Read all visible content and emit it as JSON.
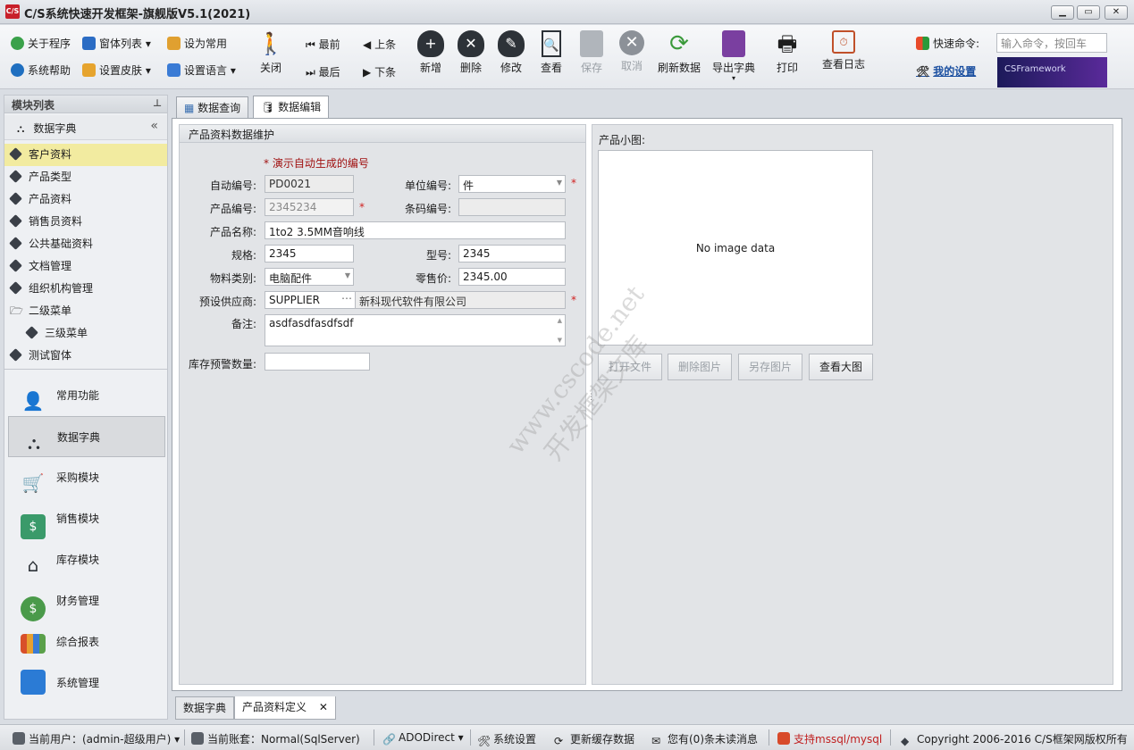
{
  "window": {
    "title": "C/S系统快速开发框架-旗舰版V5.1(2021)",
    "logo": "C/S"
  },
  "toolbar": {
    "small_buttons": [
      {
        "label": "关于程序",
        "icon": "question-green-icon"
      },
      {
        "label": "窗体列表",
        "icon": "windows-list-icon"
      },
      {
        "label": "设为常用",
        "icon": "bookmark-icon"
      },
      {
        "label": "系统帮助",
        "icon": "help-blue-icon"
      },
      {
        "label": "设置皮肤",
        "icon": "skin-icon"
      },
      {
        "label": "设置语言",
        "icon": "language-icon"
      }
    ],
    "close_label": "关闭",
    "nav": {
      "first": "最前",
      "prev": "上条",
      "last": "最后",
      "next": "下条"
    },
    "buttons": [
      {
        "label": "新增",
        "icon": "database-add-icon",
        "enabled": true
      },
      {
        "label": "删除",
        "icon": "database-delete-icon",
        "enabled": true
      },
      {
        "label": "修改",
        "icon": "database-edit-icon",
        "enabled": true
      },
      {
        "label": "查看",
        "icon": "view-document-icon",
        "enabled": true
      },
      {
        "label": "保存",
        "icon": "save-disk-icon",
        "enabled": false
      },
      {
        "label": "取消",
        "icon": "cancel-circle-icon",
        "enabled": false
      },
      {
        "label": "刷新数据",
        "icon": "refresh-icon",
        "enabled": true
      },
      {
        "label": "导出字典",
        "icon": "export-disk-icon",
        "enabled": true
      },
      {
        "label": "打印",
        "icon": "printer-icon",
        "enabled": true
      },
      {
        "label": "查看日志",
        "icon": "calendar-log-icon",
        "enabled": true
      }
    ],
    "quick_command_label": "快速命令:",
    "quick_command_placeholder": "输入命令，按回车",
    "my_settings": "我的设置",
    "brand_banner": "CSFramework"
  },
  "left_panel": {
    "header": "模块列表",
    "group_title": "数据字典",
    "tree": [
      {
        "label": "客户资料",
        "selected": true,
        "level": 0
      },
      {
        "label": "产品类型",
        "selected": false,
        "level": 0
      },
      {
        "label": "产品资料",
        "selected": false,
        "level": 0
      },
      {
        "label": "销售员资料",
        "selected": false,
        "level": 0
      },
      {
        "label": "公共基础资料",
        "selected": false,
        "level": 0
      },
      {
        "label": "文档管理",
        "selected": false,
        "level": 0
      },
      {
        "label": "组织机构管理",
        "selected": false,
        "level": 0
      },
      {
        "label": "二级菜单",
        "selected": false,
        "level": 0
      },
      {
        "label": "三级菜单",
        "selected": false,
        "level": 1
      },
      {
        "label": "测试窗体",
        "selected": false,
        "level": 0
      }
    ],
    "modules": [
      {
        "label": "常用功能",
        "icon": "user-location-icon"
      },
      {
        "label": "数据字典",
        "icon": "hierarchy-icon",
        "active": true
      },
      {
        "label": "采购模块",
        "icon": "cart-icon"
      },
      {
        "label": "销售模块",
        "icon": "sales-tag-icon"
      },
      {
        "label": "库存模块",
        "icon": "warehouse-house-icon"
      },
      {
        "label": "财务管理",
        "icon": "coins-icon"
      },
      {
        "label": "综合报表",
        "icon": "bar-chart-icon"
      },
      {
        "label": "系统管理",
        "icon": "windows-logo-icon"
      }
    ]
  },
  "tabs": [
    {
      "label": "数据查询",
      "icon": "grid-icon"
    },
    {
      "label": "数据编辑",
      "icon": "database-icon",
      "active": true
    }
  ],
  "form": {
    "title": "产品资料数据维护",
    "note": "* 演示自动生成的编号",
    "labels": {
      "auto_no": "自动编号:",
      "unit_no": "单位编号:",
      "product_no": "产品编号:",
      "barcode": "条码编号:",
      "name": "产品名称:",
      "spec": "规格:",
      "model": "型号:",
      "category": "物料类别:",
      "price": "零售价:",
      "supplier": "预设供应商:",
      "remark": "备注:",
      "stock_alert": "库存预警数量:"
    },
    "values": {
      "auto_no": "PD0021",
      "unit_no": "件",
      "product_no": "2345234",
      "barcode": "",
      "name": "1to2 3.5MM音响线",
      "spec": "2345",
      "model": "2345",
      "category": "电脑配件",
      "price": "2345.00",
      "supplier_code": "SUPPLIER",
      "supplier_name": "新科现代软件有限公司",
      "remark": "asdfasdfasdfsdf",
      "stock_alert": ""
    },
    "required_mark": "*"
  },
  "image_panel": {
    "label": "产品小图:",
    "placeholder": "No image data",
    "buttons": [
      {
        "label": "打开文件",
        "enabled": false
      },
      {
        "label": "删除图片",
        "enabled": false
      },
      {
        "label": "另存图片",
        "enabled": false
      },
      {
        "label": "查看大图",
        "enabled": true
      }
    ]
  },
  "watermark": {
    "line1": "www.cscode.net",
    "line2": "开发框架文库"
  },
  "bottom_tabs": [
    {
      "label": "数据字典"
    },
    {
      "label": "产品资料定义",
      "active": true,
      "close": "✕"
    }
  ],
  "status": {
    "user": "当前用户：(admin-超级用户)",
    "account": "当前账套：Normal(SqlServer)",
    "db": "ADODirect",
    "settings": "系统设置",
    "refresh": "更新缓存数据",
    "messages": "您有(0)条未读消息",
    "support": "支持mssql/mysql",
    "copyright": "Copyright 2006-2016 C/S框架网版权所有"
  },
  "colors": {
    "selected_tree": "#f2eba0",
    "required": "#d02020",
    "note": "#a01010",
    "link": "#1a4fa0"
  }
}
